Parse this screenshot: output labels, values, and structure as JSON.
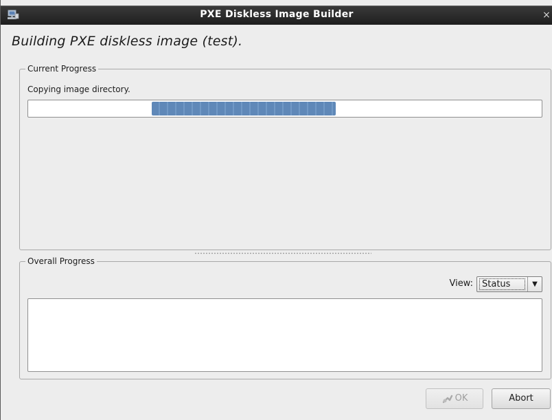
{
  "window": {
    "title": "PXE Diskless Image Builder",
    "close_glyph": "×",
    "icon": "computer-network-icon"
  },
  "heading": "Building PXE diskless image (test).",
  "current_progress": {
    "group_label": "Current Progress",
    "status": "Copying image directory.",
    "progress_mode": "indeterminate"
  },
  "overall_progress": {
    "group_label": "Overall Progress",
    "view_label": "View:",
    "view_selected": "Status",
    "log_text": ""
  },
  "buttons": {
    "ok_label": "OK",
    "ok_enabled": false,
    "abort_label": "Abort"
  },
  "colors": {
    "titlebar": "#2b2b2b",
    "progress_fill": "#5f88b8",
    "window_bg": "#ededed"
  }
}
